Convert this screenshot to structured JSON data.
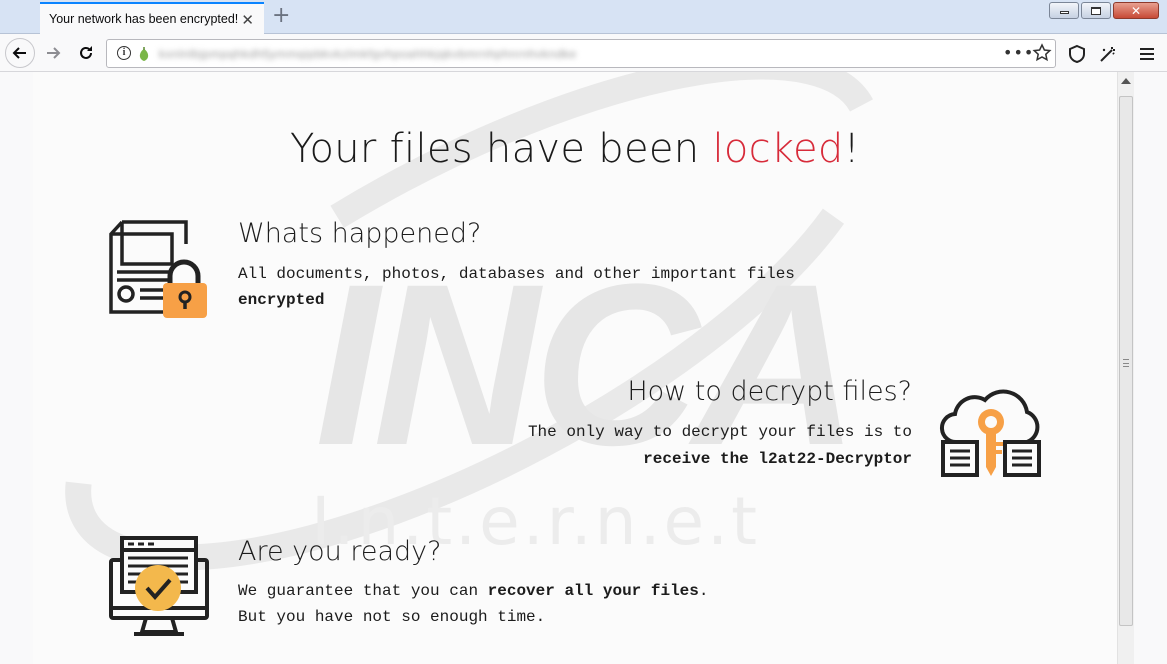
{
  "browser": {
    "tab_title": "Your network has been encrypted!",
    "url": "kxnlnlbjpmpqhkdhfjymmqipbkvkzlmkfgvhpoahhkjqkvbmrnhphnrnhvkndke"
  },
  "page": {
    "title_prefix": "Your files have been ",
    "title_highlight": "locked",
    "title_suffix": "!",
    "section1": {
      "heading": "Whats happened?",
      "line1": "All documents, photos, databases and other important files",
      "line2": "encrypted"
    },
    "section2": {
      "heading": "How to decrypt files?",
      "line1": "The only way to decrypt your files is to",
      "line2": "receive the l2at22-Decryptor"
    },
    "section3": {
      "heading": "Are you ready?",
      "line1_pre": "We guarantee that you can ",
      "line1_bold": "recover all your files",
      "line1_post": ".",
      "line2": "But you have not so enough time."
    },
    "watermark": {
      "logo": "INCA",
      "sub": "I.n.t.e.r.n.e.t"
    }
  },
  "colors": {
    "accent_red": "#d72b3a",
    "accent_orange": "#f7a046",
    "check_yellow": "#f3b84c"
  },
  "icons": [
    "document-lock-icon",
    "cloud-key-icon",
    "monitor-check-icon",
    "info-icon",
    "shield-icon",
    "star-icon",
    "hamburger-menu-icon"
  ]
}
